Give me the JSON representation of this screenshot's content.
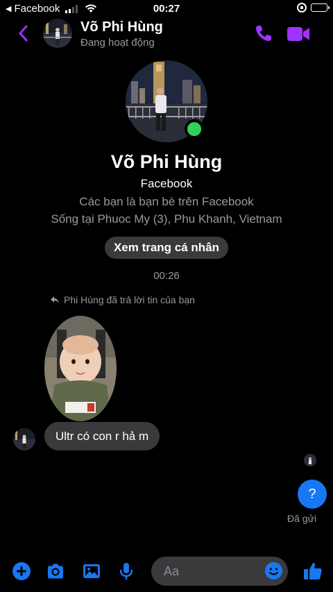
{
  "status_bar": {
    "back_app": "Facebook",
    "time": "00:27"
  },
  "header": {
    "name": "Võ Phi Hùng",
    "status": "Đang hoạt động"
  },
  "profile": {
    "name": "Võ Phi Hùng",
    "app": "Facebook",
    "friends_note": "Các bạn là bạn bè trên Facebook",
    "location": "Sống tại Phuoc My (3), Phu Khanh, Vietnam",
    "view_profile_label": "Xem trang cá nhân"
  },
  "conversation": {
    "timestamp": "00:26",
    "reply_note": "Phi Hùng đã trả lời tin của bạn",
    "incoming_text": "Ultr có con r hả m",
    "outgoing_text": "?",
    "sent_label": "Đã gửi"
  },
  "composer": {
    "placeholder": "Aa"
  },
  "colors": {
    "accent_purple": "#a033ff",
    "messenger_blue": "#1877f2",
    "online_green": "#31d158",
    "bubble_gray": "#3a3a3c"
  },
  "icons": {
    "back": "chevron-left-icon",
    "call": "phone-icon",
    "video": "video-camera-icon",
    "add": "plus-circle-icon",
    "camera": "camera-icon",
    "gallery": "image-icon",
    "mic": "microphone-icon",
    "emoji": "smiley-icon",
    "like": "thumbs-up-icon"
  }
}
